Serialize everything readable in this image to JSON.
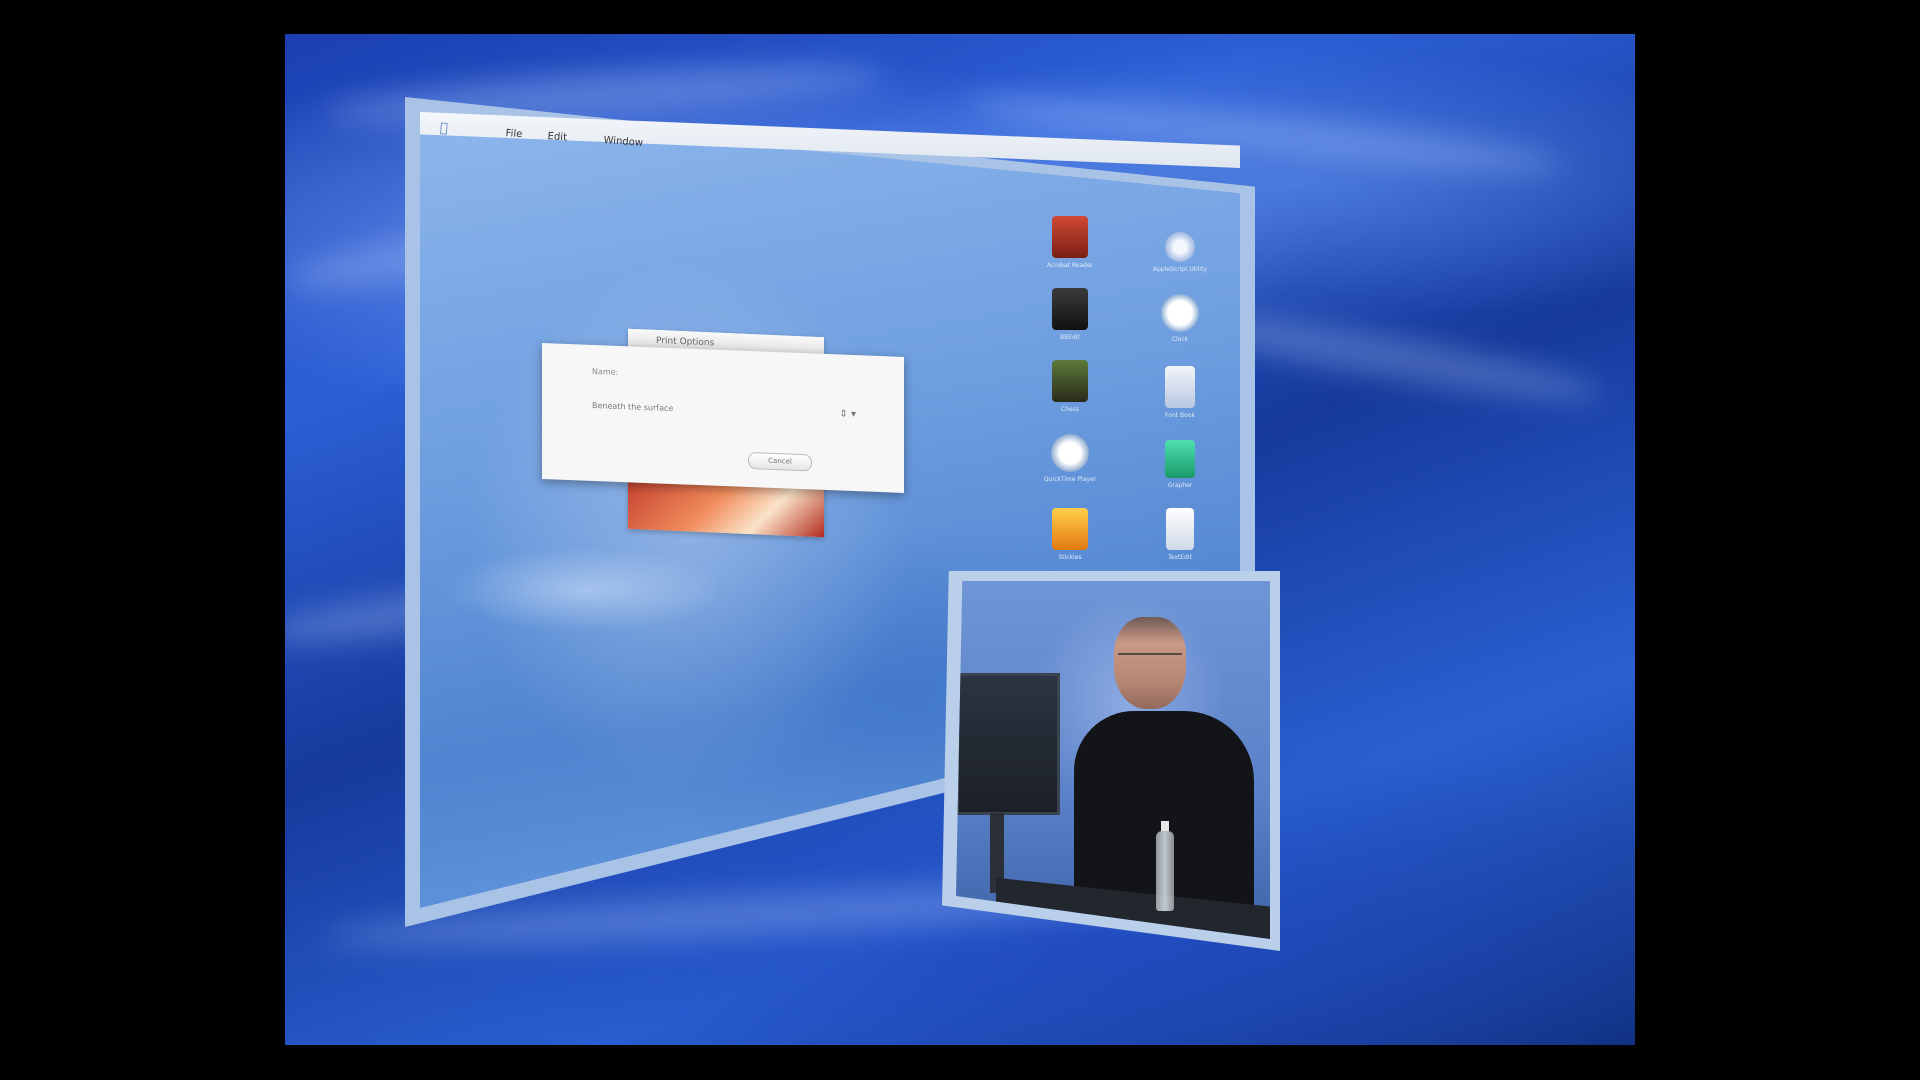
{
  "menubar": {
    "apple_symbol": "",
    "items": [
      "File",
      "Edit",
      "Window"
    ]
  },
  "dialog": {
    "back_title": "Print Options",
    "text_line1": "Name:",
    "text_line2": "Beneath the surface",
    "button_label": "Cancel"
  },
  "desktop_icons": [
    {
      "label": "Acrobat Reader",
      "color": "#b33a2a"
    },
    {
      "label": "AppleScript Utility",
      "color": "#c9d7ea"
    },
    {
      "label": "BBEdit",
      "color": "#2b2b2b"
    },
    {
      "label": "Clock",
      "color": "#eef3fa"
    },
    {
      "label": "Chess",
      "color": "#3d5a2a"
    },
    {
      "label": "Font Book",
      "color": "#e2e6ee"
    },
    {
      "label": "QuickTime Player",
      "color": "#e0e6f2"
    },
    {
      "label": "Grapher",
      "color": "#2fbf8a"
    },
    {
      "label": "Stickies",
      "color": "#f0a020"
    },
    {
      "label": "TextEdit",
      "color": "#f1f4f8"
    }
  ],
  "colors": {
    "background_accent": "#2c5fd6",
    "frame": "#a9c3e6"
  }
}
